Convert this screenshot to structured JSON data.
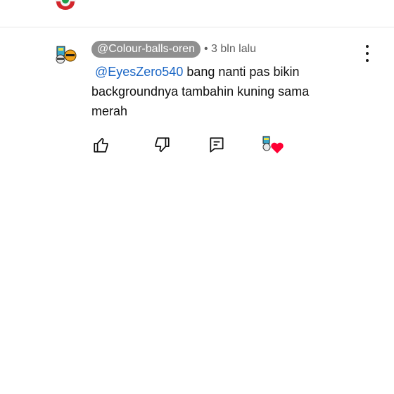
{
  "previous_comment": {
    "text": ""
  },
  "comment": {
    "author": "@Colour-balls-oren",
    "time": "• 3 bln lalu",
    "mention": "@EyesZero540",
    "text": "bang nanti pas bikin backgroundnya tambahin kuning sama merah"
  },
  "actions": {
    "like_icon": "thumbs-up-icon",
    "dislike_icon": "thumbs-down-icon",
    "reply_icon": "reply-icon",
    "hearted_icon": "creator-heart-icon"
  },
  "colors": {
    "author_pill": "#8f8f8f",
    "mention": "#1a66c5",
    "heart": "#ff0033"
  }
}
